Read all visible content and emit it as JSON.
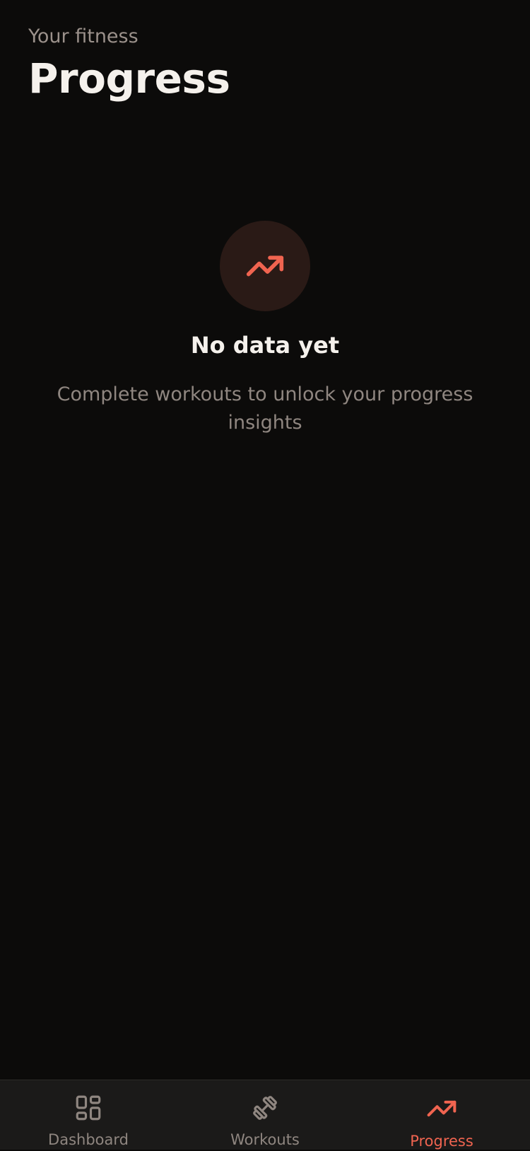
{
  "header": {
    "eyebrow": "Your fitness",
    "title": "Progress"
  },
  "empty_state": {
    "icon": "trending-up-icon",
    "title": "No data yet",
    "description": "Complete workouts to unlock your progress insights"
  },
  "tabbar": {
    "tabs": [
      {
        "label": "Dashboard",
        "icon": "dashboard-grid-icon",
        "active": false
      },
      {
        "label": "Workouts",
        "icon": "dumbbell-icon",
        "active": false
      },
      {
        "label": "Progress",
        "icon": "trending-up-icon",
        "active": true
      }
    ]
  },
  "colors": {
    "background": "#0c0b0a",
    "accent": "#f06450",
    "icon_circle_bg": "#2a1a16",
    "tabbar_bg": "#1b1a19",
    "muted_text": "#8f8680",
    "primary_text": "#f5f1ec"
  }
}
